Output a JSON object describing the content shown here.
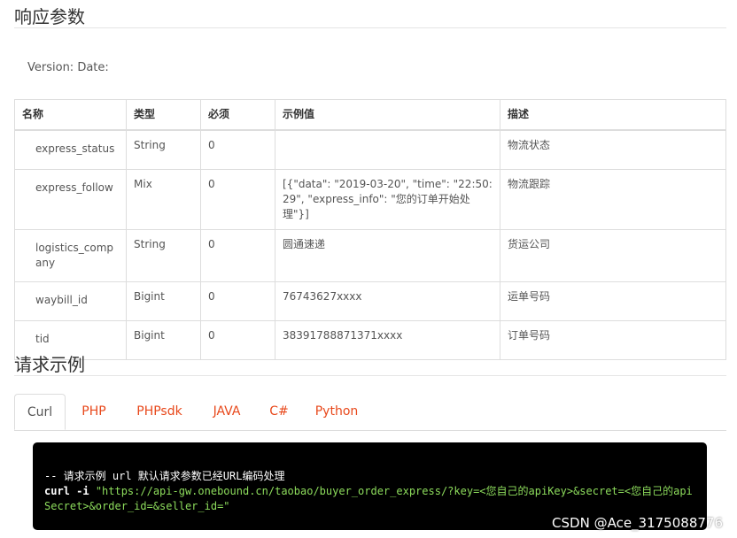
{
  "response_section": {
    "title": "响应参数",
    "version_line": "Version: Date:"
  },
  "params_table": {
    "headers": [
      "名称",
      "类型",
      "必须",
      "示例值",
      "描述"
    ],
    "rows": [
      {
        "name": "express_status",
        "type": "String",
        "required": "0",
        "example": "",
        "desc": "物流状态"
      },
      {
        "name": "express_follow",
        "type": "Mix",
        "required": "0",
        "example": "[{\"data\": \"2019-03-20\", \"time\": \"22:50:29\", \"express_info\": \"您的订单开始处理\"}]",
        "desc": "物流跟踪"
      },
      {
        "name": "logistics_company",
        "type": "String",
        "required": "0",
        "example": "圆通速递",
        "desc": "货运公司"
      },
      {
        "name": "waybill_id",
        "type": "Bigint",
        "required": "0",
        "example": "76743627xxxx",
        "desc": "运单号码"
      },
      {
        "name": "tid",
        "type": "Bigint",
        "required": "0",
        "example": "38391788871371xxxx",
        "desc": "订单号码"
      }
    ]
  },
  "request_section": {
    "title": "请求示例",
    "tabs": [
      "Curl",
      "PHP",
      "PHPsdk",
      "JAVA",
      "C#",
      "Python"
    ],
    "active_tab": "Curl"
  },
  "code_block": {
    "comment": "-- 请求示例 url 默认请求参数已经URL编码处理",
    "command": "curl -i",
    "url": "\"https://api-gw.onebound.cn/taobao/buyer_order_express/?key=<您自己的apiKey>&secret=<您自己的apiSecret>&order_id=&seller_id=\""
  },
  "watermark": "CSDN @Ace_3175088776",
  "colors": {
    "tab_link": "#e8481b",
    "code_bg": "#000000",
    "code_string": "#8ddc5c"
  }
}
